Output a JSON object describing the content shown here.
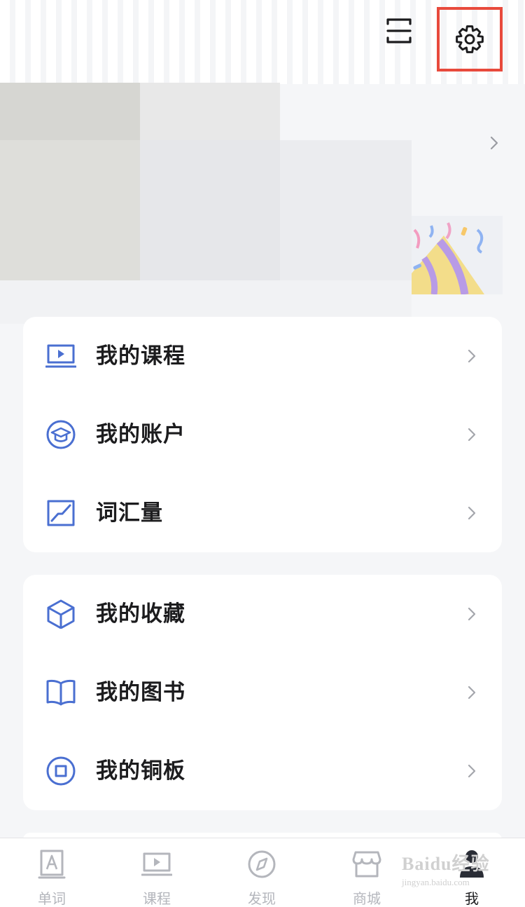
{
  "header": {
    "scan_icon": "scan-icon",
    "settings_icon": "gear-icon",
    "highlight_color": "#e84a3c"
  },
  "menu_group_1": [
    {
      "label": "我的课程",
      "icon": "course-screen-icon"
    },
    {
      "label": "我的账户",
      "icon": "graduation-cap-icon"
    },
    {
      "label": "词汇量",
      "icon": "trend-chart-icon"
    }
  ],
  "menu_group_2": [
    {
      "label": "我的收藏",
      "icon": "cube-icon"
    },
    {
      "label": "我的图书",
      "icon": "book-icon"
    },
    {
      "label": "我的铜板",
      "icon": "coin-icon"
    }
  ],
  "tabbar": {
    "tabs": [
      {
        "label": "单词",
        "icon": "word-card-icon",
        "active": false
      },
      {
        "label": "课程",
        "icon": "video-course-icon",
        "active": false
      },
      {
        "label": "发现",
        "icon": "compass-icon",
        "active": false
      },
      {
        "label": "商城",
        "icon": "store-icon",
        "active": false
      },
      {
        "label": "我",
        "icon": "profile-icon",
        "active": true
      }
    ]
  },
  "watermark": {
    "brand": "Baidu经验",
    "url": "jingyan.baidu.com"
  },
  "colors": {
    "accent": "#4a6fd1",
    "inactive": "#b4b6bc",
    "background": "#f5f6f8"
  }
}
